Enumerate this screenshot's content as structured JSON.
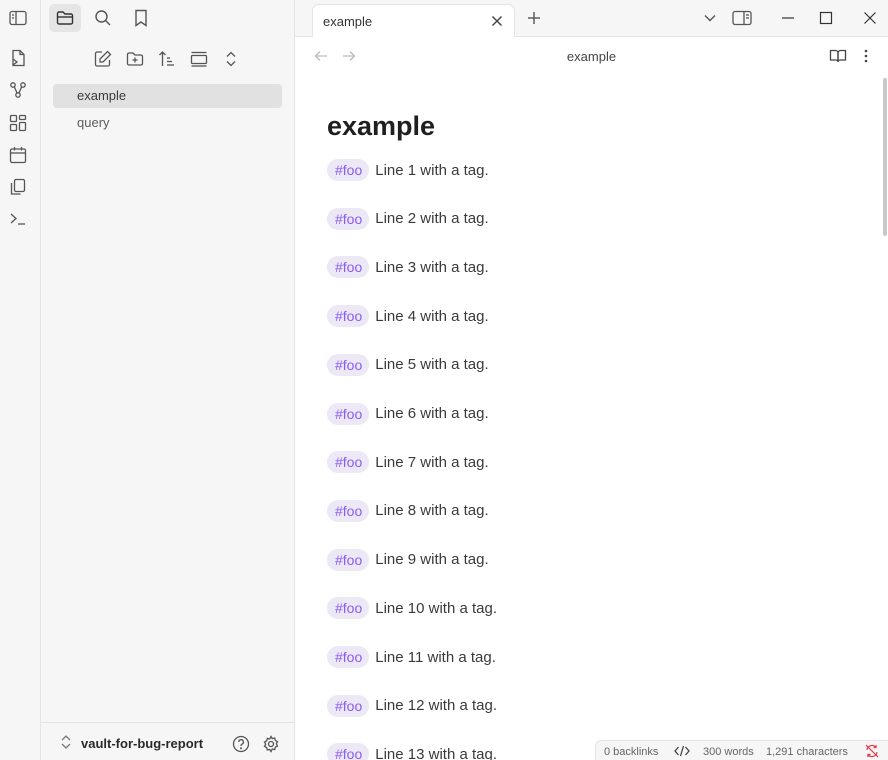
{
  "ribbon": {
    "icons": [
      "toggle-sidebar-icon",
      "open-quick-switcher-icon",
      "graph-view-icon",
      "canvas-icon",
      "daily-notes-icon",
      "templates-icon",
      "command-palette-icon"
    ]
  },
  "sidebar": {
    "tabs": [
      "files-tab",
      "search-tab",
      "bookmarks-tab"
    ],
    "nav_actions": [
      "new-note",
      "new-folder",
      "sort",
      "auto-reveal",
      "collapse-all"
    ],
    "files": [
      {
        "label": "example",
        "active": true
      },
      {
        "label": "query",
        "active": false
      }
    ],
    "vault": {
      "name": "vault-for-bug-report"
    }
  },
  "titlebar": {
    "tab_label": "example"
  },
  "view": {
    "title": "example"
  },
  "document": {
    "title": "example",
    "tag": "#foo",
    "lines": [
      "Line 1 with a tag.",
      "Line 2 with a tag.",
      "Line 3 with a tag.",
      "Line 4 with a tag.",
      "Line 5 with a tag.",
      "Line 6 with a tag.",
      "Line 7 with a tag.",
      "Line 8 with a tag.",
      "Line 9 with a tag.",
      "Line 10 with a tag.",
      "Line 11 with a tag.",
      "Line 12 with a tag.",
      "Line 13 with a tag."
    ]
  },
  "statusbar": {
    "backlinks": "0 backlinks",
    "words": "300 words",
    "characters": "1,291 characters"
  },
  "colors": {
    "tag_text": "#8a5cf5",
    "tag_bg": "#ece8f6",
    "sync_error": "#e93147"
  }
}
